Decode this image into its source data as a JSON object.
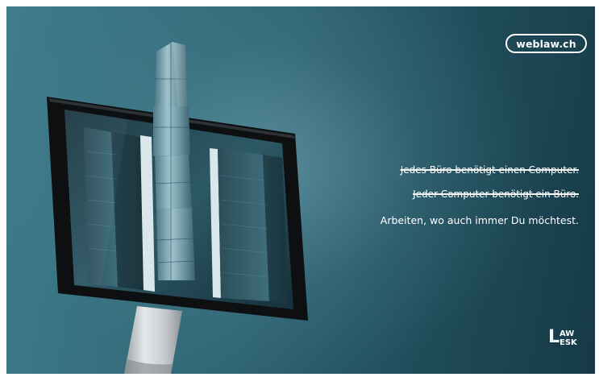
{
  "ad": {
    "brand_url": "weblaw.ch",
    "lines": [
      "Jedes Büro benötigt einen Computer.",
      "Jeder Computer benötigt ein Büro.",
      "Arbeiten, wo auch immer Du möchtest."
    ],
    "struck_lines": [
      true,
      true,
      false
    ],
    "logo": {
      "glyph": "L",
      "line1": "AW",
      "line2": "ESK"
    }
  },
  "colors": {
    "background_left": "#3f7d8c",
    "background_right": "#163a47",
    "text": "#ffffff"
  },
  "icons": [
    "computer-monitor-illustration",
    "skyscraper-illustration",
    "lawdesk-logo-icon"
  ]
}
